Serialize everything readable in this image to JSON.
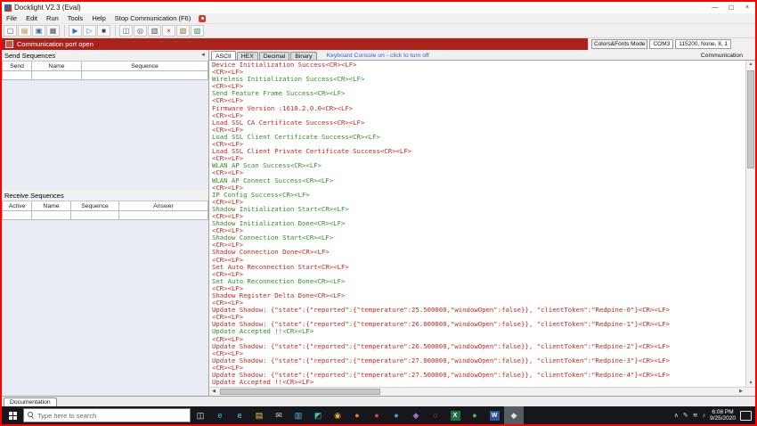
{
  "window": {
    "title": "Docklight V2.3 (Eval)",
    "controls": {
      "minimize": "—",
      "maximize": "☐",
      "close": "×"
    }
  },
  "menu": {
    "items": [
      "File",
      "Edit",
      "Run",
      "Tools",
      "Help",
      "Stop Communication  (F6)"
    ]
  },
  "toolbar": {
    "buttons": [
      {
        "name": "new-file-button",
        "glyph": "▢",
        "color": "#444444"
      },
      {
        "name": "open-file-button",
        "glyph": "▤",
        "color": "#b98a2f"
      },
      {
        "name": "save-button",
        "glyph": "▣",
        "color": "#3a62a8"
      },
      {
        "name": "print-button",
        "glyph": "▦",
        "color": "#555555"
      },
      {
        "sep": true
      },
      {
        "name": "start-communication-button",
        "glyph": "▶",
        "color": "#2e6fd0"
      },
      {
        "name": "run-once-button",
        "glyph": "▷",
        "color": "#2e6fd0"
      },
      {
        "name": "stop-button",
        "glyph": "■",
        "color": "#444444"
      },
      {
        "sep": true
      },
      {
        "name": "comm-mode-button",
        "glyph": "◫",
        "color": "#3a62a8"
      },
      {
        "name": "find-button",
        "glyph": "◎",
        "color": "#555555"
      },
      {
        "name": "keyboard-console-button",
        "glyph": "▥",
        "color": "#444444"
      },
      {
        "name": "stop-comm-red-button",
        "glyph": "×",
        "color": "#cc2222"
      },
      {
        "name": "options-button",
        "glyph": "▧",
        "color": "#8a6f3a"
      },
      {
        "name": "font-settings-button",
        "glyph": "▨",
        "color": "#3a8a5f"
      }
    ]
  },
  "banner": {
    "text": "Communication port open"
  },
  "comm_settings": {
    "colors_fonts_label": "Colors&Fonts Mode",
    "port": "COM3",
    "params": "115200, None, 8, 1"
  },
  "send_sequences": {
    "title": "Send Sequences",
    "columns": [
      "Send",
      "Name",
      "Sequence"
    ]
  },
  "receive_sequences": {
    "title": "Receive Sequences",
    "columns": [
      "Active",
      "Name",
      "Sequence",
      "Answer"
    ]
  },
  "comm_panel": {
    "tabs": [
      {
        "label": "ASCII",
        "active": true
      },
      {
        "label": "HEX",
        "active": false
      },
      {
        "label": "Decimal",
        "active": false
      },
      {
        "label": "Binary",
        "active": false
      }
    ],
    "console_link": "Keyboard Console on - click to turn off",
    "side_label": "Communication",
    "log": [
      {
        "t": "Device Initialization Success<CR><LF>",
        "c": "red"
      },
      {
        "t": "<CR><LF>",
        "c": "red"
      },
      {
        "t": "Wireless Initialization Success<CR><LF>",
        "c": "green"
      },
      {
        "t": "<CR><LF>",
        "c": "red"
      },
      {
        "t": "Send Feature Frame Success<CR><LF>",
        "c": "green"
      },
      {
        "t": "<CR><LF>",
        "c": "red"
      },
      {
        "t": "Firmware Version :1610.2.0.0<CR><LF>",
        "c": "red"
      },
      {
        "t": "<CR><LF>",
        "c": "red"
      },
      {
        "t": "Load SSL CA Certificate Success<CR><LF>",
        "c": "red"
      },
      {
        "t": "<CR><LF>",
        "c": "red"
      },
      {
        "t": "Load SSL Client Certificate Success<CR><LF>",
        "c": "green"
      },
      {
        "t": "<CR><LF>",
        "c": "red"
      },
      {
        "t": "Load SSL Client Private Certificate Success<CR><LF>",
        "c": "red"
      },
      {
        "t": "<CR><LF>",
        "c": "red"
      },
      {
        "t": "WLAN AP Scan Success<CR><LF>",
        "c": "green"
      },
      {
        "t": "<CR><LF>",
        "c": "red"
      },
      {
        "t": "WLAN AP Connect Success<CR><LF>",
        "c": "green"
      },
      {
        "t": "<CR><LF>",
        "c": "red"
      },
      {
        "t": "IP Config Success<CR><LF>",
        "c": "green"
      },
      {
        "t": "<CR><LF>",
        "c": "red"
      },
      {
        "t": "Shadow Initialization Start<CR><LF>",
        "c": "green"
      },
      {
        "t": "<CR><LF>",
        "c": "red"
      },
      {
        "t": "Shadow Initialization Done<CR><LF>",
        "c": "green"
      },
      {
        "t": "<CR><LF>",
        "c": "red"
      },
      {
        "t": "Shadow Connection Start<CR><LF>",
        "c": "green"
      },
      {
        "t": "<CR><LF>",
        "c": "red"
      },
      {
        "t": "Shadow Connection Done<CR><LF>",
        "c": "red"
      },
      {
        "t": "<CR><LF>",
        "c": "red"
      },
      {
        "t": "Set Auto Reconnection Start<CR><LF>",
        "c": "red"
      },
      {
        "t": "<CR><LF>",
        "c": "red"
      },
      {
        "t": "Set Auto Reconnection Done<CR><LF>",
        "c": "green"
      },
      {
        "t": "<CR><LF>",
        "c": "red"
      },
      {
        "t": "Shadow Register Delta Done<CR><LF>",
        "c": "red"
      },
      {
        "t": "<CR><LF>",
        "c": "red"
      },
      {
        "t": "Update Shadow: {\"state\":{\"reported\":{\"temperature\":25.500000,\"windowOpen\":false}}, \"clientToken\":\"Redpine-0\"}<CR><LF>",
        "c": "red"
      },
      {
        "t": "<CR><LF>",
        "c": "red"
      },
      {
        "t": "Update Shadow: {\"state\":{\"reported\":{\"temperature\":26.000000,\"windowOpen\":false}}, \"clientToken\":\"Redpine-1\"}<CR><LF>",
        "c": "red"
      },
      {
        "t": "Update Accepted !!<CR><LF>",
        "c": "green"
      },
      {
        "t": "<CR><LF>",
        "c": "red"
      },
      {
        "t": "Update Shadow: {\"state\":{\"reported\":{\"temperature\":26.500000,\"windowOpen\":false}}, \"clientToken\":\"Redpine-2\"}<CR><LF>",
        "c": "red"
      },
      {
        "t": "<CR><LF>",
        "c": "red"
      },
      {
        "t": "Update Shadow: {\"state\":{\"reported\":{\"temperature\":27.000000,\"windowOpen\":false}}, \"clientToken\":\"Redpine-3\"}<CR><LF>",
        "c": "red"
      },
      {
        "t": "<CR><LF>",
        "c": "red"
      },
      {
        "t": "Update Shadow: {\"state\":{\"reported\":{\"temperature\":27.500000,\"windowOpen\":false}}, \"clientToken\":\"Redpine-4\"}<CR><LF>",
        "c": "red"
      },
      {
        "t": "Update Accepted !!<CR><LF>",
        "c": "red"
      }
    ]
  },
  "doc_tab": {
    "label": "Documentation"
  },
  "taskbar": {
    "search_placeholder": "Type here to search",
    "icons": [
      {
        "name": "task-view-icon",
        "glyph": "◫",
        "fg": "#e8eaed"
      },
      {
        "name": "edge-icon",
        "glyph": "e",
        "fg": "#41b0e3"
      },
      {
        "name": "ie-icon",
        "glyph": "e",
        "fg": "#63c7f0"
      },
      {
        "name": "file-explorer-icon",
        "glyph": "▤",
        "fg": "#eec955"
      },
      {
        "name": "mail-icon",
        "glyph": "✉",
        "fg": "#c9d3dc"
      },
      {
        "name": "store-icon",
        "glyph": "▥",
        "fg": "#5fb2e8"
      },
      {
        "name": "photos-icon",
        "glyph": "◩",
        "fg": "#3fbfae"
      },
      {
        "name": "chrome-icon",
        "glyph": "◉",
        "fg": "#f0a83c"
      },
      {
        "name": "firefox-icon",
        "glyph": "●",
        "fg": "#f4772e"
      },
      {
        "name": "app-red-icon",
        "glyph": "●",
        "fg": "#e0493f"
      },
      {
        "name": "skype-icon",
        "glyph": "●",
        "fg": "#3fa9e8"
      },
      {
        "name": "app-purple-icon",
        "glyph": "◆",
        "fg": "#9a6fd0"
      },
      {
        "name": "opera-icon",
        "glyph": "○",
        "fg": "#ff3b4e"
      },
      {
        "name": "excel-icon",
        "glyph": "X",
        "fg": "#ffffff",
        "bg": "#1e7145"
      },
      {
        "name": "app-green-icon",
        "glyph": "●",
        "fg": "#52b55a"
      },
      {
        "name": "word-icon",
        "glyph": "W",
        "fg": "#ffffff",
        "bg": "#2b579a"
      },
      {
        "name": "capture-tool-icon",
        "glyph": "◆",
        "fg": "#dfe3e8",
        "active": true
      }
    ],
    "tray": {
      "icons": [
        {
          "name": "tray-chevron-icon",
          "glyph": "∧"
        },
        {
          "name": "pen-icon",
          "glyph": "✎"
        },
        {
          "name": "network-icon",
          "glyph": "≋"
        },
        {
          "name": "volume-icon",
          "glyph": "♪"
        }
      ],
      "time": "6:08 PM",
      "date": "9/25/2020"
    }
  },
  "icons": {
    "collapse_panel": "◄",
    "scroll_up": "▲",
    "scroll_down": "▼",
    "scroll_left": "◀",
    "scroll_right": "▶"
  },
  "colors": {
    "log_red": "#c8281e",
    "log_green": "#2c9428",
    "banner_bg": "#a8231c",
    "link_blue": "#3b5fd0",
    "screen_border": "#ff0000"
  }
}
